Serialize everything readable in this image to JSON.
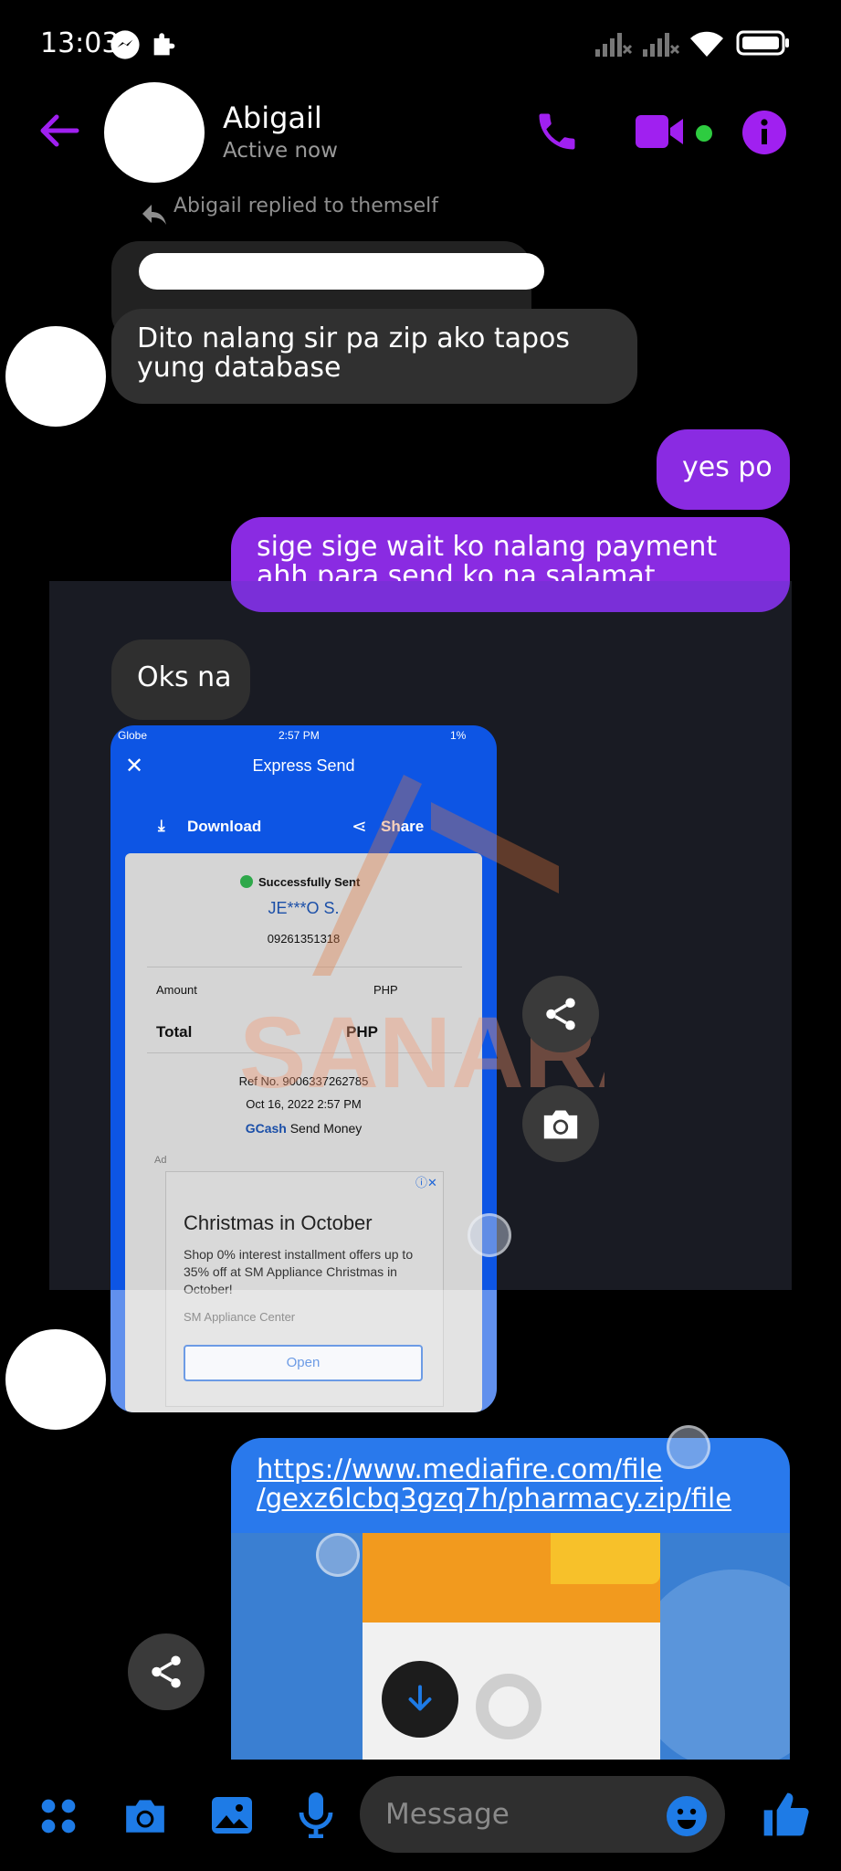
{
  "status_bar": {
    "time": "13:03"
  },
  "header": {
    "contact_name": "Abigail",
    "contact_status": "Active now",
    "colors": {
      "accent": "#a020f0",
      "online": "#2ecc40"
    }
  },
  "messages": {
    "reply_note": "Abigail replied to themself",
    "m1": "Dito nalang sir pa zip ako tapos yung database",
    "m2": "yes po",
    "m3": "sige sige wait ko nalang payment ahh para send ko na salamat",
    "m4": "Oks na"
  },
  "receipt": {
    "carrier": "Globe",
    "time": "2:57 PM",
    "battery": "1%",
    "title": "Express Send",
    "download": "Download",
    "share": "Share",
    "success": "Successfully Sent",
    "recipient": "JE***O S.",
    "number": "09261351318",
    "amount_label": "Amount",
    "amount_currency": "PHP",
    "total_label": "Total",
    "total_currency": "PHP",
    "ref": "Ref No. 9006337262785",
    "date": "Oct 16, 2022 2:57 PM",
    "brand": "GCash",
    "brand_suffix": " Send Money",
    "ad_label": "Ad",
    "ad_title": "Christmas in October",
    "ad_body": "Shop 0% interest installment offers up to 35% off at SM Appliance Christmas in October!",
    "ad_source": "SM Appliance Center",
    "ad_button": "Open"
  },
  "watermark": "SANARA",
  "link": {
    "url": "https://www.mediafire.com/file/gexz6lcbq3gzq7h/pharmacy.zip/file",
    "line1": "https://www.mediafire.com/file",
    "line2": "/gexz6lcbq3gzq7h/pharmacy.zip/file"
  },
  "composer": {
    "placeholder": "Message"
  }
}
